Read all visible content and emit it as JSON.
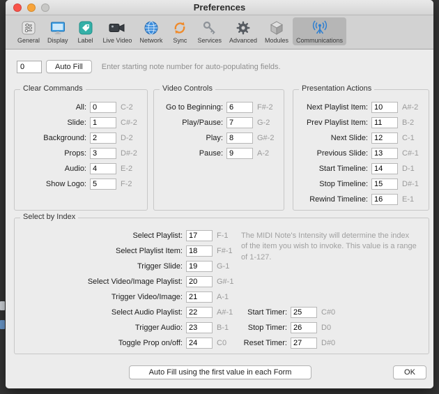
{
  "window": {
    "title": "Preferences"
  },
  "colors": {
    "toolbar_selected_bg": "#b6b6b6",
    "accent_blue": "#2e7fd1",
    "sync_orange": "#ef8a2a",
    "label_teal": "#35b0a8",
    "content_bg": "#ececec"
  },
  "toolbar": {
    "items": [
      {
        "label": "General"
      },
      {
        "label": "Display"
      },
      {
        "label": "Label"
      },
      {
        "label": "Live Video"
      },
      {
        "label": "Network"
      },
      {
        "label": "Sync"
      },
      {
        "label": "Services"
      },
      {
        "label": "Advanced"
      },
      {
        "label": "Modules"
      },
      {
        "label": "Communications",
        "selected": true
      }
    ]
  },
  "autofill": {
    "value": "0",
    "button_label": "Auto Fill",
    "hint": "Enter starting note number for auto-populating fields."
  },
  "groups": {
    "clear": {
      "title": "Clear Commands",
      "rows": [
        {
          "label": "All:",
          "value": "0",
          "note": "C-2"
        },
        {
          "label": "Slide:",
          "value": "1",
          "note": "C#-2"
        },
        {
          "label": "Background:",
          "value": "2",
          "note": "D-2"
        },
        {
          "label": "Props:",
          "value": "3",
          "note": "D#-2"
        },
        {
          "label": "Audio:",
          "value": "4",
          "note": "E-2"
        },
        {
          "label": "Show Logo:",
          "value": "5",
          "note": "F-2"
        }
      ]
    },
    "video": {
      "title": "Video Controls",
      "rows": [
        {
          "label": "Go to Beginning:",
          "value": "6",
          "note": "F#-2"
        },
        {
          "label": "Play/Pause:",
          "value": "7",
          "note": "G-2"
        },
        {
          "label": "Play:",
          "value": "8",
          "note": "G#-2"
        },
        {
          "label": "Pause:",
          "value": "9",
          "note": "A-2"
        }
      ]
    },
    "presentation": {
      "title": "Presentation Actions",
      "rows": [
        {
          "label": "Next Playlist Item:",
          "value": "10",
          "note": "A#-2"
        },
        {
          "label": "Prev Playlist Item:",
          "value": "11",
          "note": "B-2"
        },
        {
          "label": "Next Slide:",
          "value": "12",
          "note": "C-1"
        },
        {
          "label": "Previous Slide:",
          "value": "13",
          "note": "C#-1"
        },
        {
          "label": "Start Timeline:",
          "value": "14",
          "note": "D-1"
        },
        {
          "label": "Stop Timeline:",
          "value": "15",
          "note": "D#-1"
        },
        {
          "label": "Rewind Timeline:",
          "value": "16",
          "note": "E-1"
        }
      ]
    },
    "select": {
      "title": "Select by Index",
      "rows": [
        {
          "label": "Select Playlist:",
          "value": "17",
          "note": "F-1"
        },
        {
          "label": "Select Playlist Item:",
          "value": "18",
          "note": "F#-1"
        },
        {
          "label": "Trigger Slide:",
          "value": "19",
          "note": "G-1"
        },
        {
          "label": "Select Video/Image Playlist:",
          "value": "20",
          "note": "G#-1"
        },
        {
          "label": "Trigger Video/Image:",
          "value": "21",
          "note": "A-1"
        },
        {
          "label": "Select Audio Playlist:",
          "value": "22",
          "note": "A#-1"
        },
        {
          "label": "Trigger Audio:",
          "value": "23",
          "note": "B-1"
        },
        {
          "label": "Toggle Prop on/off:",
          "value": "24",
          "note": "C0"
        }
      ],
      "info": "The MIDI Note's Intensity will determine the index of the item you wish to invoke. This value is a range of 1-127.",
      "timer_rows": [
        {
          "label": "Start Timer:",
          "value": "25",
          "note": "C#0"
        },
        {
          "label": "Stop Timer:",
          "value": "26",
          "note": "D0"
        },
        {
          "label": "Reset Timer:",
          "value": "27",
          "note": "D#0"
        }
      ]
    }
  },
  "footer": {
    "auto_fill_all_label": "Auto Fill using the first value in each Form",
    "ok_label": "OK"
  }
}
